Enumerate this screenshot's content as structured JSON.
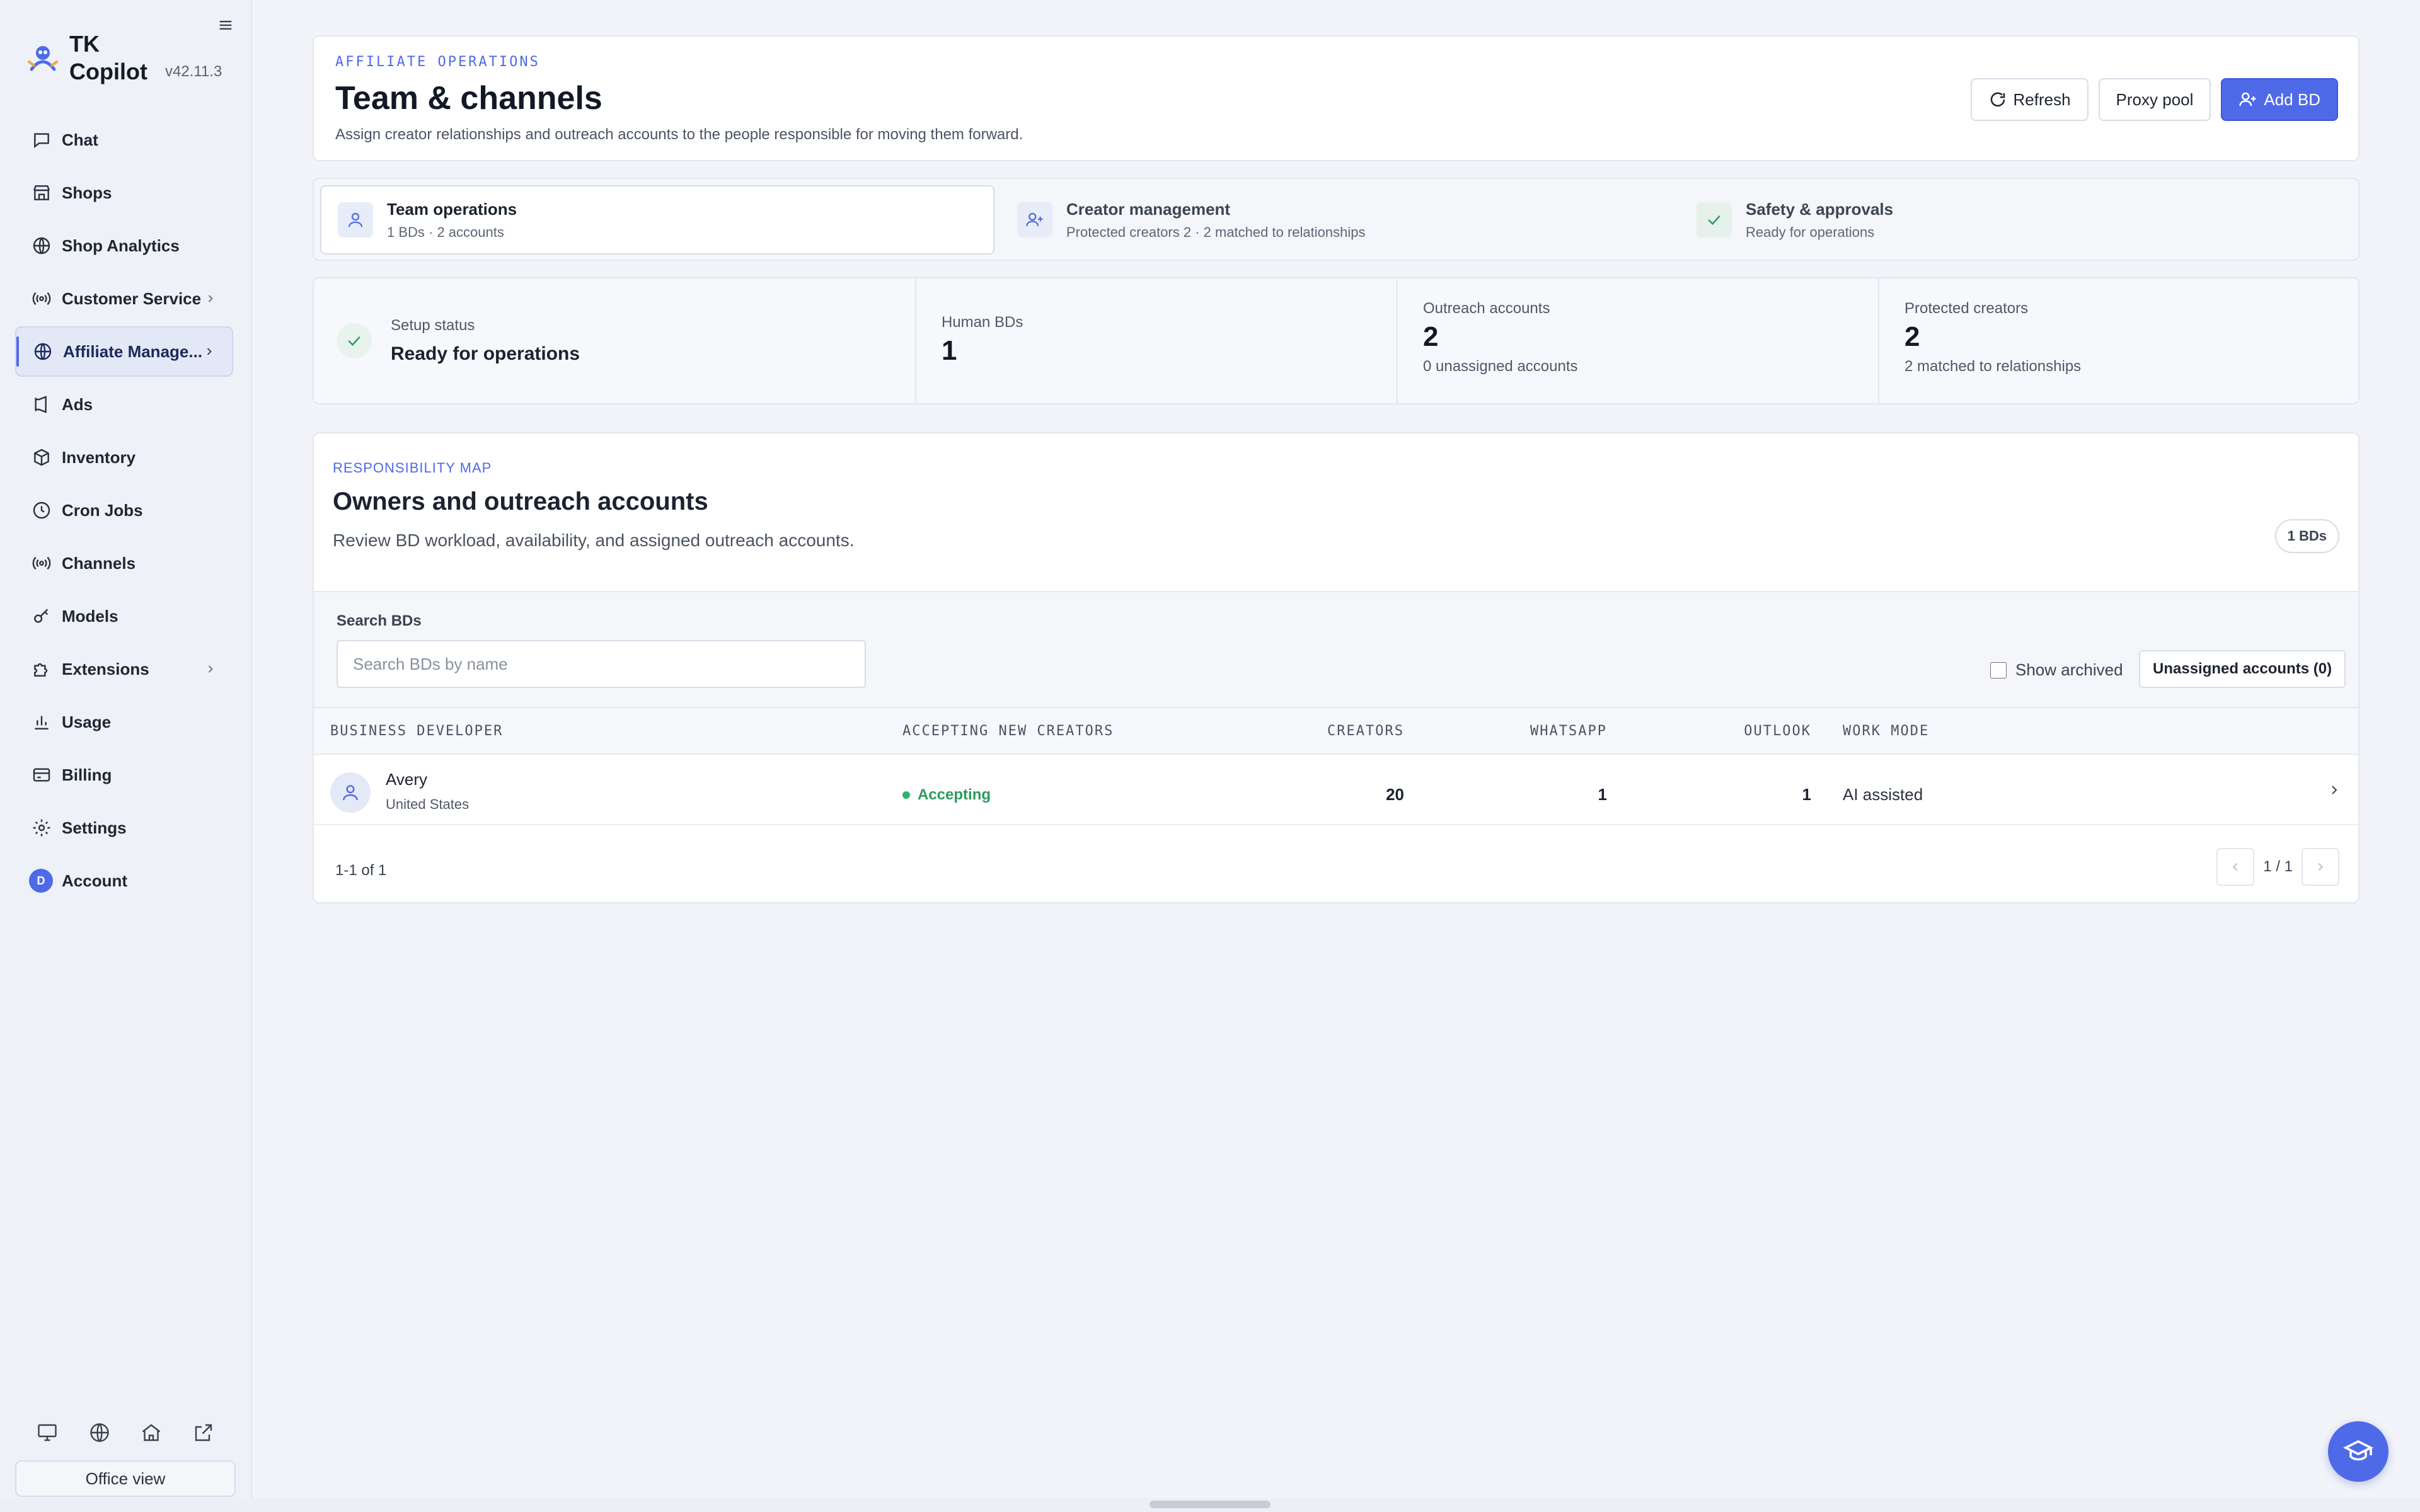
{
  "app": {
    "name": "TK Copilot",
    "version": "v42.11.3"
  },
  "sidebar": {
    "items": [
      {
        "label": "Chat",
        "icon": "chat-icon"
      },
      {
        "label": "Shops",
        "icon": "store-icon"
      },
      {
        "label": "Shop Analytics",
        "icon": "globe-icon"
      },
      {
        "label": "Customer Service",
        "icon": "broadcast-icon"
      },
      {
        "label": "Affiliate Manage...",
        "icon": "globe-icon"
      },
      {
        "label": "Ads",
        "icon": "megaphone-icon"
      },
      {
        "label": "Inventory",
        "icon": "box-icon"
      },
      {
        "label": "Cron Jobs",
        "icon": "clock-icon"
      },
      {
        "label": "Channels",
        "icon": "broadcast-icon"
      },
      {
        "label": "Models",
        "icon": "key-icon"
      },
      {
        "label": "Extensions",
        "icon": "puzzle-icon"
      },
      {
        "label": "Usage",
        "icon": "bar-chart-icon"
      },
      {
        "label": "Billing",
        "icon": "credit-card-icon"
      },
      {
        "label": "Settings",
        "icon": "gear-icon"
      },
      {
        "label": "Account",
        "avatar_letter": "D"
      }
    ],
    "office_view": "Office view"
  },
  "header": {
    "kicker": "AFFILIATE OPERATIONS",
    "title": "Team & channels",
    "subtitle": "Assign creator relationships and outreach accounts to the people responsible for moving them forward.",
    "refresh": "Refresh",
    "proxy_pool": "Proxy pool",
    "add_bd": "Add BD"
  },
  "tabs": [
    {
      "title": "Team operations",
      "sub": "1 BDs · 2 accounts"
    },
    {
      "title": "Creator management",
      "sub": "Protected creators 2 · 2 matched to relationships"
    },
    {
      "title": "Safety & approvals",
      "sub": "Ready for operations"
    }
  ],
  "stats": {
    "setup": {
      "label": "Setup status",
      "value": "Ready for operations"
    },
    "human_bds": {
      "label": "Human BDs",
      "value": "1"
    },
    "outreach": {
      "label": "Outreach accounts",
      "value": "2",
      "note": "0 unassigned accounts"
    },
    "protected": {
      "label": "Protected creators",
      "value": "2",
      "note": "2 matched to relationships"
    }
  },
  "map": {
    "kicker": "RESPONSIBILITY MAP",
    "title": "Owners and outreach accounts",
    "subtitle": "Review BD workload, availability, and assigned outreach accounts.",
    "count_pill": "1 BDs",
    "search_label": "Search BDs",
    "search_placeholder": "Search BDs by name",
    "search_value": "",
    "show_archived": "Show archived",
    "unassigned_btn": "Unassigned accounts (0)",
    "columns": {
      "bd": "BUSINESS DEVELOPER",
      "accepting": "ACCEPTING NEW CREATORS",
      "creators": "CREATORS",
      "whatsapp": "WHATSAPP",
      "outlook": "OUTLOOK",
      "work_mode": "WORK MODE"
    },
    "rows": [
      {
        "name": "Avery",
        "country": "United States",
        "accepting": "Accepting",
        "creators": "20",
        "whatsapp": "1",
        "outlook": "1",
        "work_mode": "AI assisted"
      }
    ],
    "range": "1-1 of 1",
    "page": "1 / 1"
  },
  "colors": {
    "accent": "#4f6ae8",
    "success": "#2b9b5e"
  }
}
